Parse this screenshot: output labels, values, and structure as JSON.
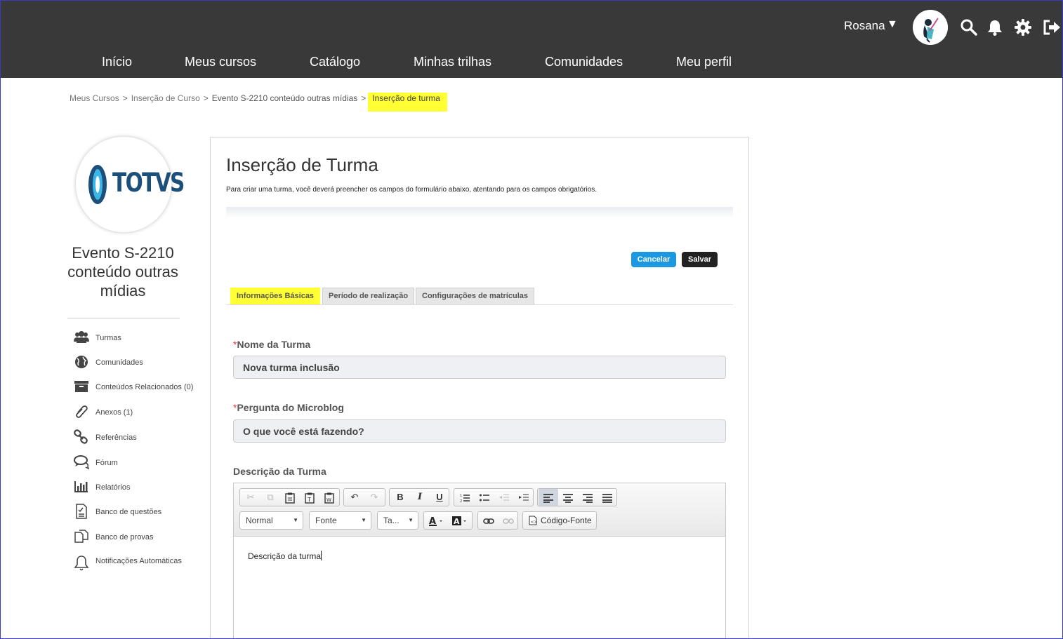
{
  "header": {
    "user_name": "Rosana",
    "user_caret": "▼",
    "icons": [
      "search-icon",
      "bell-icon",
      "gear-icon",
      "logout-icon"
    ],
    "nav": [
      "Início",
      "Meus cursos",
      "Catálogo",
      "Minhas trilhas",
      "Comunidades",
      "Meu perfil"
    ]
  },
  "breadcrumb": {
    "items": [
      "Meus Cursos",
      "Inserção de Curso",
      "Evento S-2210 conteúdo outras mídias"
    ],
    "separator": ">",
    "current": "Inserção de turma"
  },
  "course": {
    "logo_text": "TOTVS",
    "title": "Evento S-2210 conteúdo outras mídias"
  },
  "sidebar": {
    "items": [
      {
        "label": "Turmas",
        "icon": "users-icon"
      },
      {
        "label": "Comunidades",
        "icon": "globe-icon"
      },
      {
        "label": "Conteúdos Relacionados (0)",
        "icon": "archive-icon"
      },
      {
        "label": "Anexos (1)",
        "icon": "paperclip-icon"
      },
      {
        "label": "Referências",
        "icon": "link-icon"
      },
      {
        "label": "Fórum",
        "icon": "comments-icon"
      },
      {
        "label": "Relatórios",
        "icon": "bar-chart-icon"
      },
      {
        "label": "Banco de questões",
        "icon": "checklist-icon"
      },
      {
        "label": "Banco de provas",
        "icon": "copy-icon"
      },
      {
        "label": "Notificações Automáticas",
        "icon": "bell-outline-icon"
      }
    ]
  },
  "main": {
    "title": "Inserção de Turma",
    "description": "Para criar uma turma, você deverá preencher os campos do formulário abaixo, atentando para os campos obrigatórios.",
    "buttons": {
      "cancel": "Cancelar",
      "save": "Salvar"
    },
    "tabs": [
      "Informações Básicas",
      "Período de realização",
      "Configurações de matrículas"
    ],
    "active_tab": "Informações Básicas",
    "fields": {
      "nome": {
        "required_mark": "*",
        "label": "Nome da Turma",
        "value": "Nova turma inclusão"
      },
      "pergunta": {
        "required_mark": "*",
        "label": "Pergunta do Microblog",
        "value": "O que você está fazendo?"
      },
      "descricao": {
        "label": "Descrição da Turma",
        "content": "Descrição da turma"
      }
    },
    "editor_toolbar": {
      "format": "Normal",
      "font": "Fonte",
      "size": "Ta...",
      "source": "Código-Fonte",
      "bold": "B",
      "italic": "I",
      "underline": "U"
    }
  },
  "colors": {
    "header_bg": "#393939",
    "highlight": "#ffff33",
    "cancel_button": "#1b98e0",
    "save_button": "#222222"
  }
}
